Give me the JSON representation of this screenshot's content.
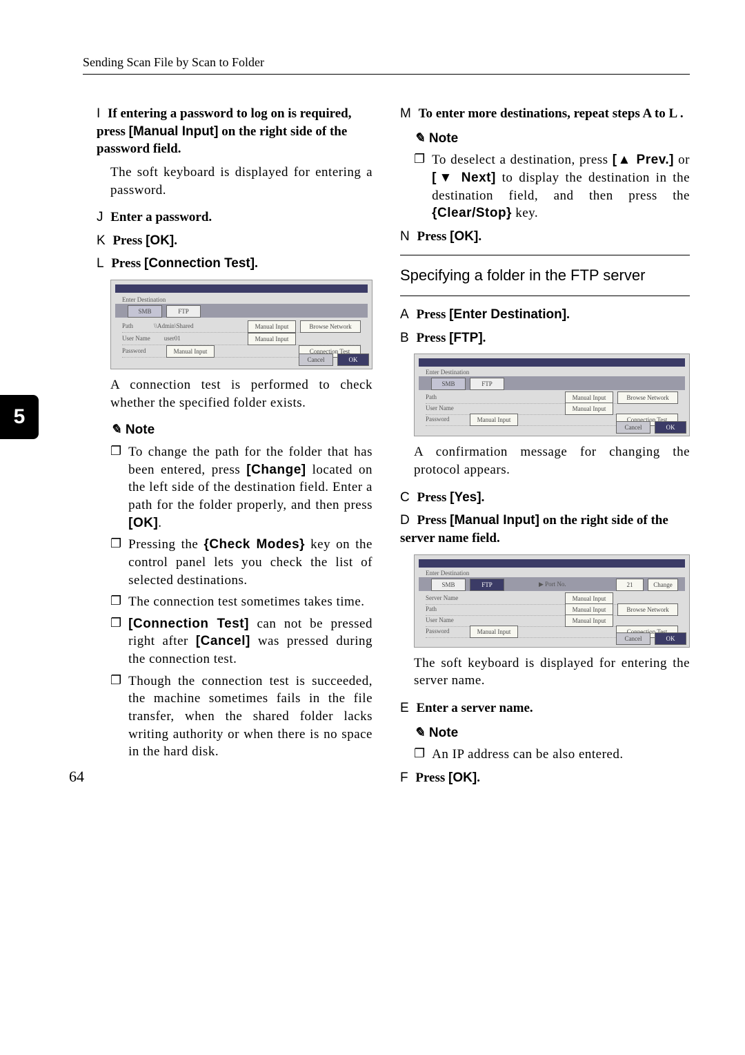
{
  "running_head": "Sending Scan File by Scan to Folder",
  "page_number": "64",
  "side_tab": "5",
  "left": {
    "step_I": {
      "label": "I",
      "text": "If entering a password to log on is required, press [Manual Input] on the right side of the password field."
    },
    "para_I": "The soft keyboard is displayed for entering a password.",
    "step_J": {
      "label": "J",
      "text": "Enter a password."
    },
    "step_K": {
      "label": "K",
      "prefix": "Press ",
      "key": "[OK]",
      "suffix": "."
    },
    "step_L": {
      "label": "L",
      "prefix": "Press ",
      "key": "[Connection Test]",
      "suffix": "."
    },
    "para_L": "A connection test is performed to check whether the specified folder exists.",
    "note_label": "Note",
    "bullets_L": [
      {
        "pre": "To change the path for the folder that has been entered, press ",
        "k1": "[Change]",
        "mid": " located on the left side of the destination field. Enter a path for the folder properly, and then press ",
        "k2": "[OK]",
        "post": "."
      },
      {
        "pre": "Pressing the ",
        "k1": "{Check Modes}",
        "mid": " key on the control panel lets you check the list of selected destinations.",
        "k2": "",
        "post": ""
      },
      {
        "pre": "The connection test sometimes takes time.",
        "k1": "",
        "mid": "",
        "k2": "",
        "post": ""
      },
      {
        "pre": "",
        "k1": "[Connection Test]",
        "mid": " can not be pressed right after ",
        "k2": "[Cancel]",
        "post": " was pressed during the connection test."
      },
      {
        "pre": "Though the connection test is succeeded, the machine sometimes fails in the file transfer, when the shared folder lacks writing authority or when there is no space in the hard disk.",
        "k1": "",
        "mid": "",
        "k2": "",
        "post": ""
      }
    ],
    "ph1": {
      "tab1": "SMB",
      "tab2": "FTP",
      "row1_label": "Path",
      "row1_val": "\\\\Admin\\Shared",
      "row2_label": "User Name",
      "row2_val": "user01",
      "row3_label": "Password",
      "row3_val": "Manual Input",
      "btn1": "Manual Input",
      "btn2": "Browse Network",
      "btn3": "Manual Input",
      "btn4": "Connection Test",
      "cancel": "Cancel",
      "ok": "OK",
      "title": "Enter Destination"
    }
  },
  "right": {
    "step_M": {
      "label": "M",
      "text": "To enter more destinations, repeat steps A  to L ."
    },
    "note_label": "Note",
    "bullet_M": {
      "pre": "To deselect a destination, press ",
      "k1": "[▲ Prev.]",
      "mid": " or ",
      "k2": "[▼ Next]",
      "mid2": " to display the destination in the destination field, and then press the ",
      "k3": "{Clear/Stop}",
      "post": " key."
    },
    "step_N": {
      "label": "N",
      "prefix": "Press ",
      "key": "[OK]",
      "suffix": "."
    },
    "subhead": "Specifying a folder in the FTP server",
    "step_A": {
      "label": "A",
      "prefix": "Press ",
      "key": "[Enter Destination]",
      "suffix": "."
    },
    "step_B": {
      "label": "B",
      "prefix": "Press ",
      "key": "[FTP]",
      "suffix": "."
    },
    "para_B": "A confirmation message for changing the protocol appears.",
    "step_C": {
      "label": "C",
      "prefix": "Press ",
      "key": "[Yes]",
      "suffix": "."
    },
    "step_D": {
      "label": "D",
      "prefix": "Press ",
      "key": "[Manual Input]",
      "suffix": " on the right side of the server name field."
    },
    "para_D": "The soft keyboard is displayed for entering the server name.",
    "step_E": {
      "label": "E",
      "text": "Enter a server name."
    },
    "bullet_E": "An IP address can be also entered.",
    "step_F": {
      "label": "F",
      "prefix": "Press ",
      "key": "[OK]",
      "suffix": "."
    },
    "ph2": {
      "tab1": "SMB",
      "tab2": "FTP",
      "row1_label": "Path",
      "row2_label": "User Name",
      "row3_label": "Password",
      "row3_val": "Manual Input",
      "btn1": "Manual Input",
      "btn2": "Browse Network",
      "btn3": "Manual Input",
      "btn4": "Connection Test",
      "cancel": "Cancel",
      "ok": "OK",
      "title": "Enter Destination"
    },
    "ph3": {
      "tab1": "SMB",
      "tab2": "FTP",
      "portlabel": "▶ Port No.",
      "portval": "21",
      "change": "Change",
      "row1_label": "Server Name",
      "row2_label": "Path",
      "row3_label": "User Name",
      "row4_label": "Password",
      "row4_val": "Manual Input",
      "btn1": "Manual Input",
      "btn2": "Browse Network",
      "btn3": "Manual Input",
      "btn5": "Manual Input",
      "btn4": "Connection Test",
      "cancel": "Cancel",
      "ok": "OK",
      "title": "Enter Destination"
    }
  }
}
